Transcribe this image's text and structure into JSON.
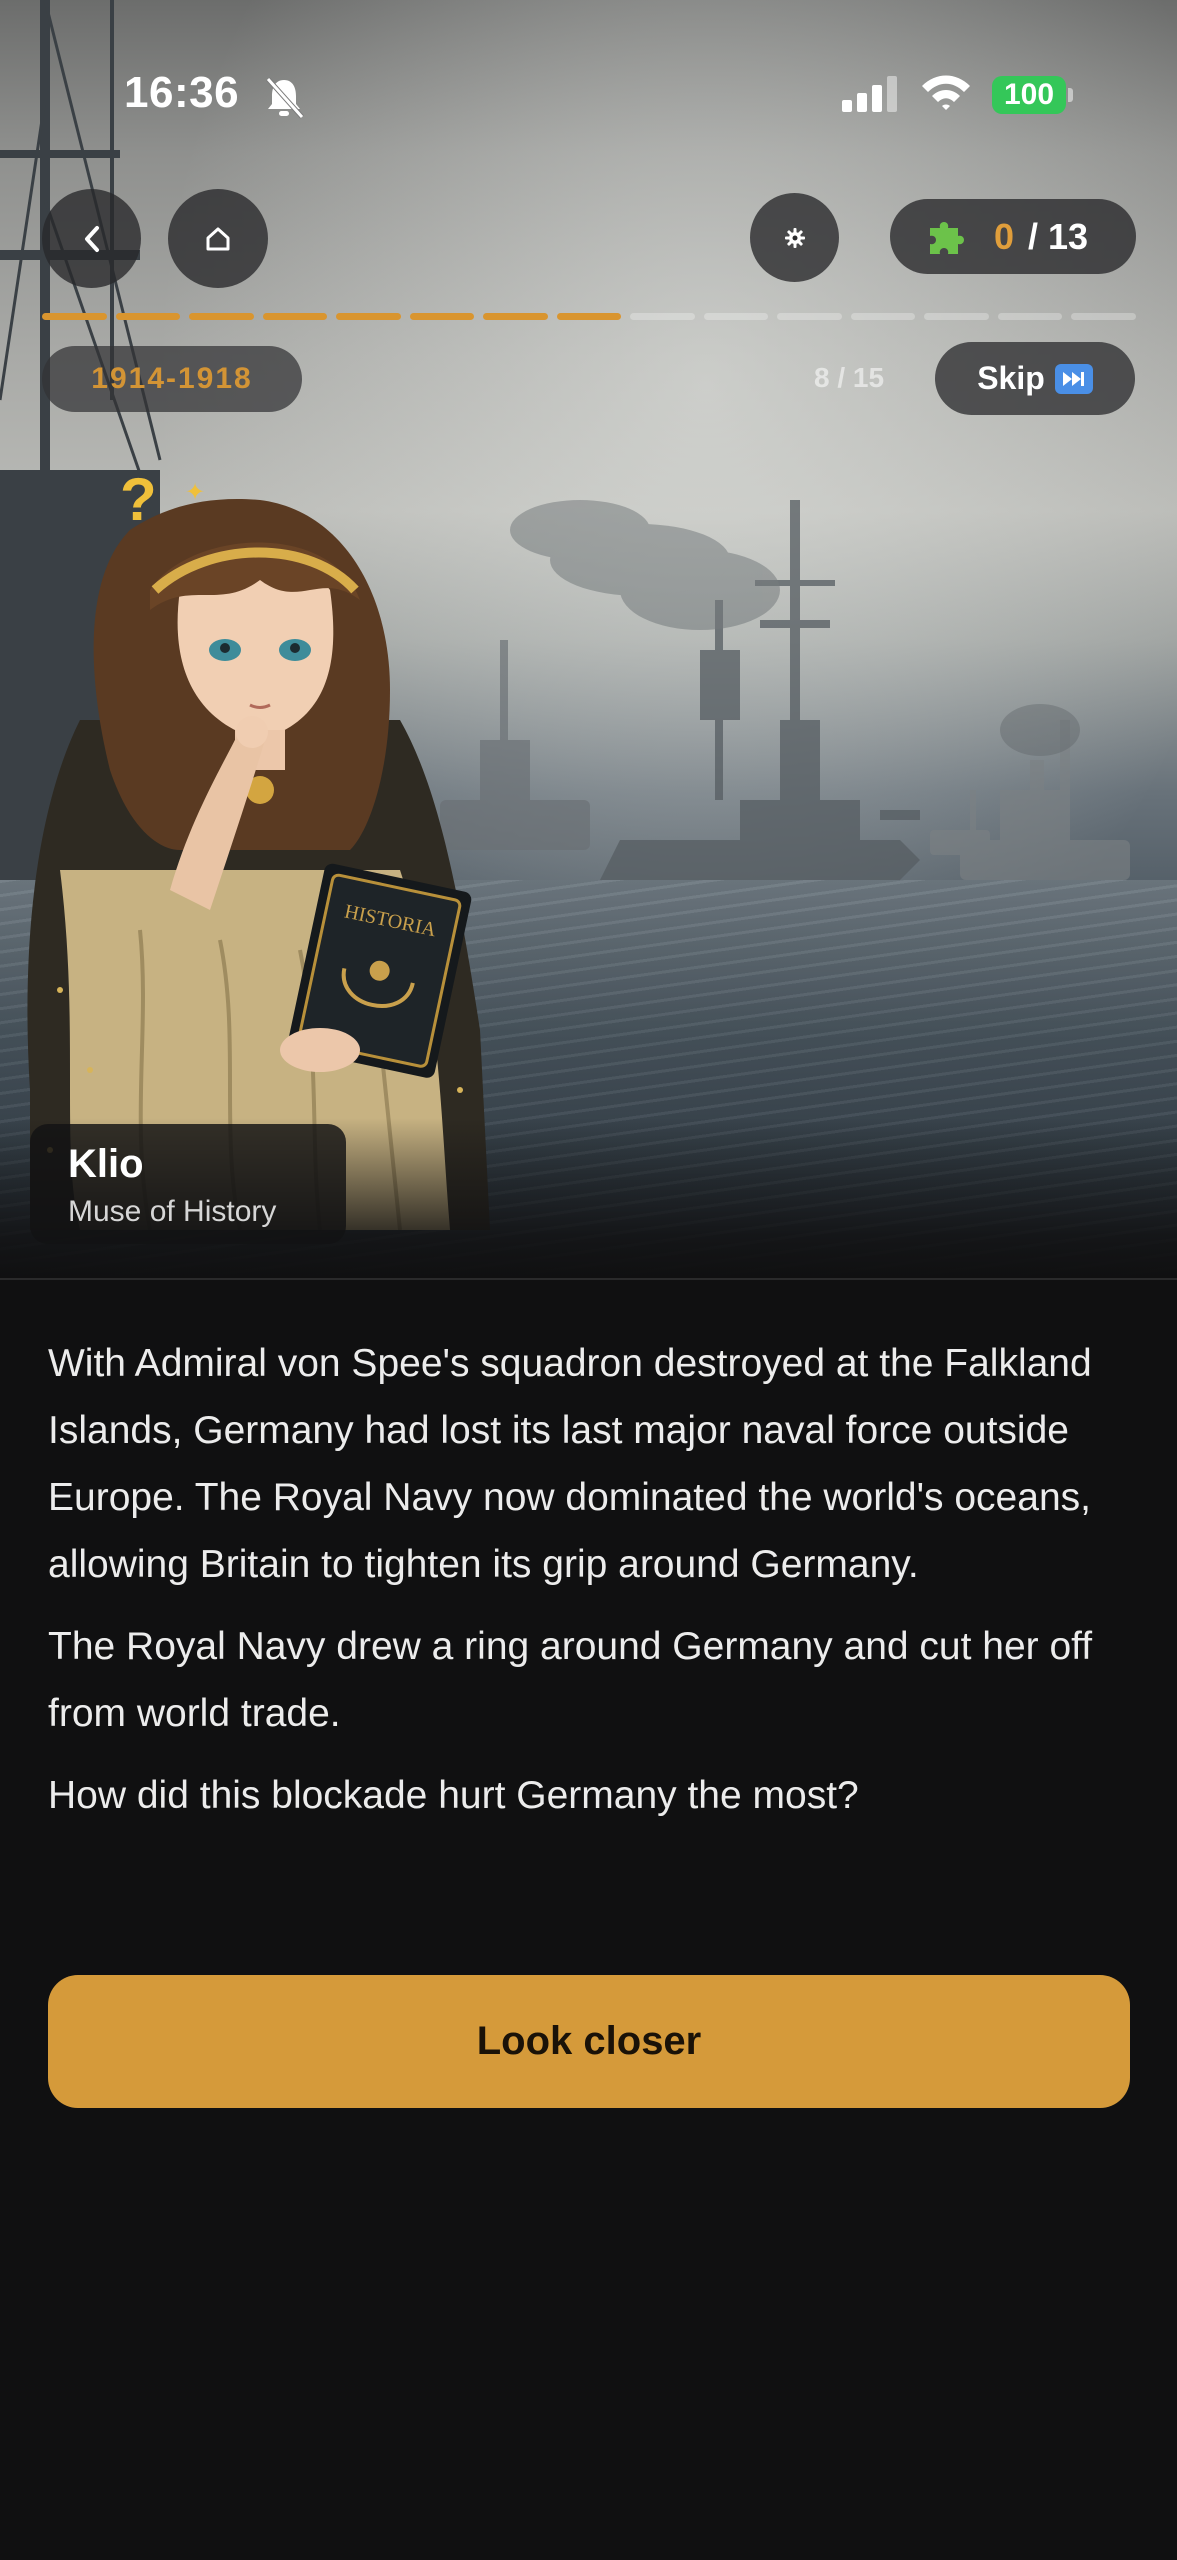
{
  "status_bar": {
    "time": "16:36",
    "battery": "100",
    "colors": {
      "battery": "#34c759"
    }
  },
  "toolbar": {
    "back_icon": "chevron-left-icon",
    "home_icon": "home-icon",
    "settings_icon": "gear-icon",
    "pieces": {
      "icon": "puzzle-piece-icon",
      "collected": "0",
      "total": "/ 13"
    }
  },
  "progress": {
    "completed_segments": 8,
    "total_segments": 15
  },
  "header": {
    "era": "1914-1918",
    "step": "8 / 15",
    "skip_label": "Skip",
    "skip_icon": "fast-forward-icon"
  },
  "character": {
    "name": "Klio",
    "role": "Muse of History",
    "book_label": "HISTORIA"
  },
  "story": {
    "paragraphs": [
      "With Admiral von Spee's squadron destroyed at the Falkland Islands, Germany had lost its last major naval force outside Europe. The Royal Navy now dominated the world's oceans, allowing Britain to tighten its grip around Germany.",
      "The Royal Navy drew a ring around Germany and cut her off from world trade.",
      "How did this blockade hurt Germany the most?"
    ]
  },
  "cta": {
    "label": "Look closer"
  },
  "colors": {
    "accent": "#d59a3a",
    "background": "#101011",
    "text": "#ececec"
  }
}
